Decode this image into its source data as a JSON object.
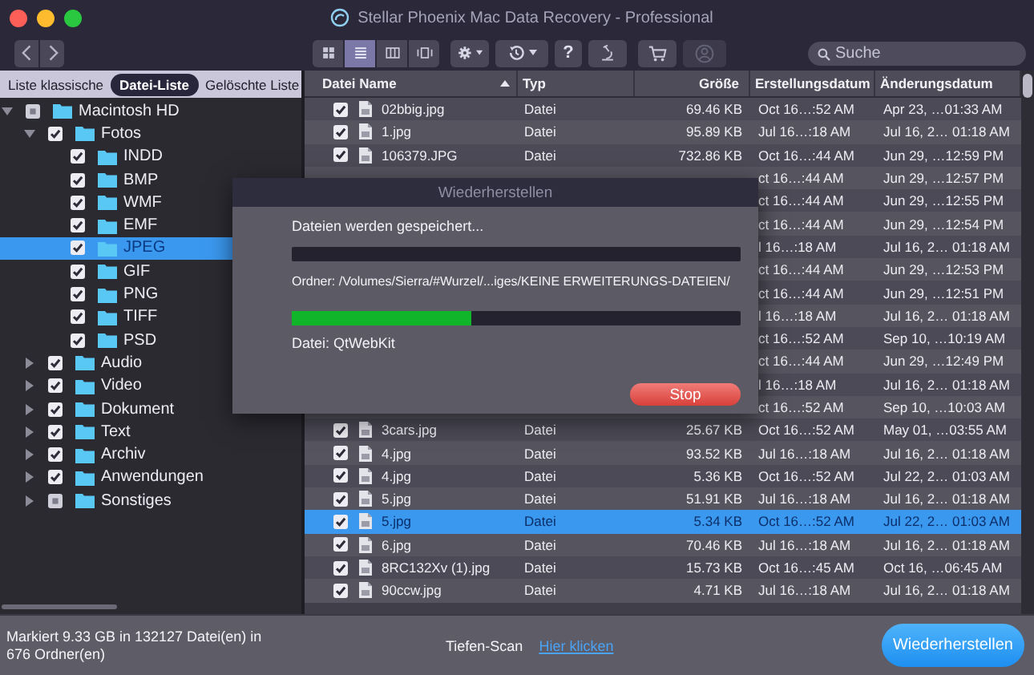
{
  "window": {
    "title": "Stellar Phoenix Mac Data Recovery - Professional"
  },
  "toolbar": {
    "nav": [
      {
        "kind": "back"
      },
      {
        "kind": "forward"
      }
    ],
    "view_modes": [
      {
        "kind": "grid",
        "selected": false
      },
      {
        "kind": "list",
        "selected": true
      },
      {
        "kind": "columns",
        "selected": false
      },
      {
        "kind": "coverflow",
        "selected": false
      }
    ],
    "tools": [
      {
        "kind": "gear",
        "menu": true
      },
      {
        "kind": "history",
        "menu": true
      },
      {
        "kind": "help",
        "label": "?",
        "menu": false
      },
      {
        "kind": "microscope",
        "menu": false
      }
    ],
    "account": [
      {
        "kind": "cart",
        "disabled": false
      },
      {
        "kind": "user",
        "disabled": true
      }
    ],
    "search": {
      "placeholder": "Suche"
    }
  },
  "sidebar_tabs": [
    {
      "label": "Liste klassische",
      "selected": false
    },
    {
      "label": "Datei-Liste",
      "selected": true
    },
    {
      "label": "Gelöschte Liste",
      "selected": false
    }
  ],
  "tree": [
    {
      "label": "Macintosh HD",
      "checked": false,
      "mixed": true,
      "expanded": true,
      "selected": false,
      "children": [
        {
          "label": "Fotos",
          "checked": true,
          "mixed": false,
          "expanded": true,
          "selected": false,
          "children": [
            {
              "label": "INDD",
              "checked": true,
              "mixed": false,
              "selected": false
            },
            {
              "label": "BMP",
              "checked": true,
              "mixed": false,
              "selected": false
            },
            {
              "label": "WMF",
              "checked": true,
              "mixed": false,
              "selected": false
            },
            {
              "label": "EMF",
              "checked": true,
              "mixed": false,
              "selected": false
            },
            {
              "label": "JPEG",
              "checked": true,
              "mixed": false,
              "selected": true
            },
            {
              "label": "GIF",
              "checked": true,
              "mixed": false,
              "selected": false
            },
            {
              "label": "PNG",
              "checked": true,
              "mixed": false,
              "selected": false
            },
            {
              "label": "TIFF",
              "checked": true,
              "mixed": false,
              "selected": false
            },
            {
              "label": "PSD",
              "checked": true,
              "mixed": false,
              "selected": false
            }
          ]
        },
        {
          "label": "Audio",
          "checked": true,
          "mixed": false,
          "expanded": false,
          "selected": false
        },
        {
          "label": "Video",
          "checked": true,
          "mixed": false,
          "expanded": false,
          "selected": false
        },
        {
          "label": "Dokument",
          "checked": true,
          "mixed": false,
          "expanded": false,
          "selected": false
        },
        {
          "label": "Text",
          "checked": true,
          "mixed": false,
          "expanded": false,
          "selected": false
        },
        {
          "label": "Archiv",
          "checked": true,
          "mixed": false,
          "expanded": false,
          "selected": false
        },
        {
          "label": "Anwendungen",
          "checked": true,
          "mixed": false,
          "expanded": false,
          "selected": false
        },
        {
          "label": "Sonstiges",
          "checked": false,
          "mixed": true,
          "expanded": false,
          "selected": false
        }
      ]
    }
  ],
  "table": {
    "columns": [
      {
        "label": "Datei Name",
        "sorted": true
      },
      {
        "label": "Typ",
        "sorted": false
      },
      {
        "label": "Größe",
        "sorted": false
      },
      {
        "label": "Erstellungsdatum",
        "sorted": false
      },
      {
        "label": "Änderungsdatum",
        "sorted": false
      }
    ],
    "rows": [
      {
        "name": "02bbig.jpg",
        "type": "Datei",
        "size": "69.46 KB",
        "created": "Oct 16…:52 AM",
        "modified": "Apr 23, …01:33 AM",
        "checked": true,
        "selected": false
      },
      {
        "name": "1.jpg",
        "type": "Datei",
        "size": "95.89 KB",
        "created": "Jul 16…:18 AM",
        "modified": "Jul 16, 2… 01:18 AM",
        "checked": true,
        "selected": false
      },
      {
        "name": "106379.JPG",
        "type": "Datei",
        "size": "732.86 KB",
        "created": "Oct 16…:44 AM",
        "modified": "Jun 29, …12:59 PM",
        "checked": true,
        "selected": false
      },
      {
        "created": "ct 16…:44 AM",
        "modified": "Jun 29, …12:57 PM"
      },
      {
        "created": "ct 16…:44 AM",
        "modified": "Jun 29, …12:55 PM"
      },
      {
        "created": "ct 16…:44 AM",
        "modified": "Jun 29, …12:54 PM"
      },
      {
        "created": "l 16…:18 AM",
        "modified": "Jul 16, 2… 01:18 AM"
      },
      {
        "created": "ct 16…:44 AM",
        "modified": "Jun 29, …12:53 PM"
      },
      {
        "created": "ct 16…:44 AM",
        "modified": "Jun 29, …12:51 PM"
      },
      {
        "created": "l 16…:18 AM",
        "modified": "Jul 16, 2… 01:18 AM"
      },
      {
        "created": "ct 16…:52 AM",
        "modified": "Sep 10, …10:19 AM"
      },
      {
        "created": "ct 16…:44 AM",
        "modified": "Jun 29, …12:49 PM"
      },
      {
        "created": "l 16…:18 AM",
        "modified": "Jul 16, 2… 01:18 AM"
      },
      {
        "created": "ct 16…:52 AM",
        "modified": "Sep 10, …10:03 AM"
      },
      {
        "name": "3cars.jpg",
        "type": "Datei",
        "size": "25.67 KB",
        "created": "Oct 16…:52 AM",
        "modified": "May 01, …03:55 AM",
        "checked": true,
        "selected": false
      },
      {
        "name": "4.jpg",
        "type": "Datei",
        "size": "93.52 KB",
        "created": "Jul 16…:18 AM",
        "modified": "Jul 16, 2… 01:18 AM",
        "checked": true,
        "selected": false
      },
      {
        "name": "4.jpg",
        "type": "Datei",
        "size": "5.36 KB",
        "created": "Oct 16…:52 AM",
        "modified": "Jul 22, 2… 01:03 AM",
        "checked": true,
        "selected": false
      },
      {
        "name": "5.jpg",
        "type": "Datei",
        "size": "51.91 KB",
        "created": "Jul 16…:18 AM",
        "modified": "Jul 16, 2… 01:18 AM",
        "checked": true,
        "selected": false
      },
      {
        "name": "5.jpg",
        "type": "Datei",
        "size": "5.34 KB",
        "created": "Oct 16…:52 AM",
        "modified": "Jul 22, 2… 01:03 AM",
        "checked": true,
        "selected": true
      },
      {
        "name": "6.jpg",
        "type": "Datei",
        "size": "70.46 KB",
        "created": "Jul 16…:18 AM",
        "modified": "Jul 16, 2… 01:18 AM",
        "checked": true,
        "selected": false
      },
      {
        "name": "8RC132Xv (1).jpg",
        "type": "Datei",
        "size": "15.73 KB",
        "created": "Oct 16…:45 AM",
        "modified": "Oct 16, …06:45 AM",
        "checked": true,
        "selected": false
      },
      {
        "name": "90ccw.jpg",
        "type": "Datei",
        "size": "4.71 KB",
        "created": "Jul 16…:18 AM",
        "modified": "Jul 16, 2… 01:18 AM",
        "checked": true,
        "selected": false
      }
    ]
  },
  "dialog": {
    "title": "Wiederherstellen",
    "status": "Dateien werden gespeichert...",
    "folder_progress": {
      "level": 0
    },
    "folder": "Ordner: /Volumes/Sierra/#Wurzel/...iges/KEINE ERWEITERUNGS-DATEIEN/",
    "file_progress": {
      "level": 0.4
    },
    "file": "Datei: QtWebKit",
    "button": "Stop"
  },
  "status_bar": {
    "summary": "Markiert 9.33 GB in 132127 Datei(en) in 676 Ordner(en)",
    "deep_scan_label": "Tiefen-Scan",
    "deep_scan_link": "Hier klicken",
    "restore_button": "Wiederherstellen"
  }
}
